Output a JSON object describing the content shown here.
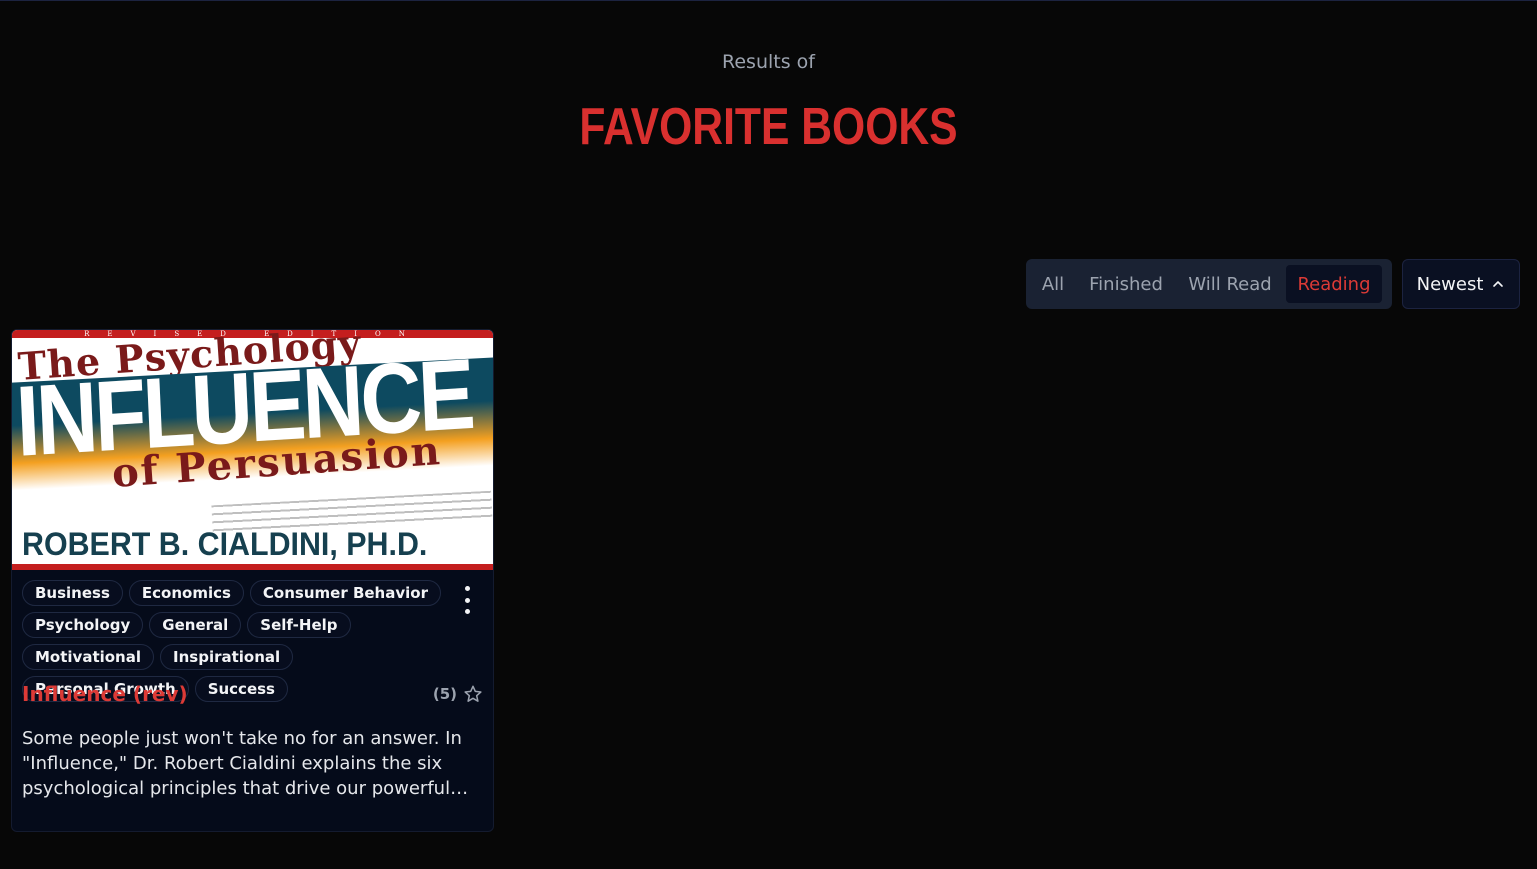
{
  "header": {
    "subtitle": "Results of",
    "title": "FAVORITE BOOKS"
  },
  "filters": {
    "tabs": [
      {
        "label": "All",
        "active": false
      },
      {
        "label": "Finished",
        "active": false
      },
      {
        "label": "Will Read",
        "active": false
      },
      {
        "label": "Reading",
        "active": true
      }
    ]
  },
  "sort": {
    "label": "Newest",
    "icon": "chevron-up-icon"
  },
  "colors": {
    "accent": "#dc3a36",
    "background": "#070707",
    "panel": "#1a2233",
    "card": "#050b1a"
  },
  "books": [
    {
      "cover": {
        "edition": "REVISED EDITION",
        "line1": "The Psychology",
        "big": "INFLUENCE",
        "line3": "of Persuasion",
        "author": "ROBERT B. CIALDINI, PH.D."
      },
      "tags": [
        "Business",
        "Economics",
        "Consumer Behavior",
        "Psychology",
        "General",
        "Self-Help",
        "Motivational",
        "Inspirational",
        "Personal Growth",
        "Success"
      ],
      "title": "Influence (rev)",
      "rating_count": "(5)",
      "rating_icon": "star-outline-icon",
      "description": "Some people just won't take no for an answer. In \"Influence,\" Dr. Robert Cialdini explains the six psychological principles that drive our powerful impulse to comply to the pressures of others."
    }
  ]
}
